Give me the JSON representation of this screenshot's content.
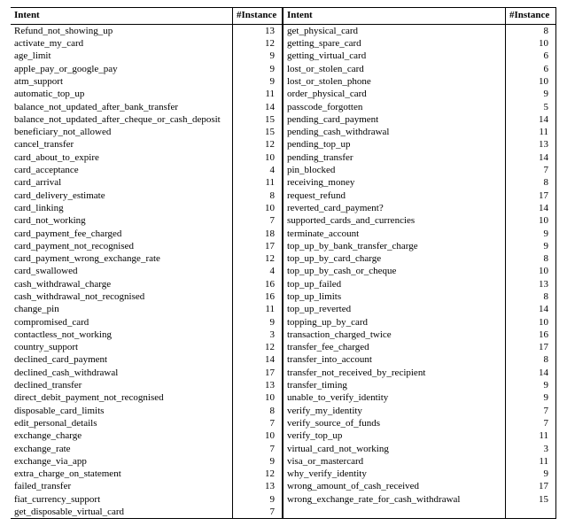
{
  "headers": {
    "intent": "Intent",
    "instance": "#Instance"
  },
  "left": [
    {
      "intent": "Refund_not_showing_up",
      "n": 13
    },
    {
      "intent": "activate_my_card",
      "n": 12
    },
    {
      "intent": "age_limit",
      "n": 9
    },
    {
      "intent": "apple_pay_or_google_pay",
      "n": 9
    },
    {
      "intent": "atm_support",
      "n": 9
    },
    {
      "intent": "automatic_top_up",
      "n": 11
    },
    {
      "intent": "balance_not_updated_after_bank_transfer",
      "n": 14
    },
    {
      "intent": "balance_not_updated_after_cheque_or_cash_deposit",
      "n": 15
    },
    {
      "intent": "beneficiary_not_allowed",
      "n": 15
    },
    {
      "intent": "cancel_transfer",
      "n": 12
    },
    {
      "intent": "card_about_to_expire",
      "n": 10
    },
    {
      "intent": "card_acceptance",
      "n": 4
    },
    {
      "intent": "card_arrival",
      "n": 11
    },
    {
      "intent": "card_delivery_estimate",
      "n": 8
    },
    {
      "intent": "card_linking",
      "n": 10
    },
    {
      "intent": "card_not_working",
      "n": 7
    },
    {
      "intent": "card_payment_fee_charged",
      "n": 18
    },
    {
      "intent": "card_payment_not_recognised",
      "n": 17
    },
    {
      "intent": "card_payment_wrong_exchange_rate",
      "n": 12
    },
    {
      "intent": "card_swallowed",
      "n": 4
    },
    {
      "intent": "cash_withdrawal_charge",
      "n": 16
    },
    {
      "intent": "cash_withdrawal_not_recognised",
      "n": 16
    },
    {
      "intent": "change_pin",
      "n": 11
    },
    {
      "intent": "compromised_card",
      "n": 9
    },
    {
      "intent": "contactless_not_working",
      "n": 3
    },
    {
      "intent": "country_support",
      "n": 12
    },
    {
      "intent": "declined_card_payment",
      "n": 14
    },
    {
      "intent": "declined_cash_withdrawal",
      "n": 17
    },
    {
      "intent": "declined_transfer",
      "n": 13
    },
    {
      "intent": "direct_debit_payment_not_recognised",
      "n": 10
    },
    {
      "intent": "disposable_card_limits",
      "n": 8
    },
    {
      "intent": "edit_personal_details",
      "n": 7
    },
    {
      "intent": "exchange_charge",
      "n": 10
    },
    {
      "intent": "exchange_rate",
      "n": 7
    },
    {
      "intent": "exchange_via_app",
      "n": 9
    },
    {
      "intent": "extra_charge_on_statement",
      "n": 12
    },
    {
      "intent": "failed_transfer",
      "n": 13
    },
    {
      "intent": "fiat_currency_support",
      "n": 9
    },
    {
      "intent": "get_disposable_virtual_card",
      "n": 7
    }
  ],
  "right": [
    {
      "intent": "get_physical_card",
      "n": 8
    },
    {
      "intent": "getting_spare_card",
      "n": 10
    },
    {
      "intent": "getting_virtual_card",
      "n": 6
    },
    {
      "intent": "lost_or_stolen_card",
      "n": 6
    },
    {
      "intent": "lost_or_stolen_phone",
      "n": 10
    },
    {
      "intent": "order_physical_card",
      "n": 9
    },
    {
      "intent": "passcode_forgotten",
      "n": 5
    },
    {
      "intent": "pending_card_payment",
      "n": 14
    },
    {
      "intent": "pending_cash_withdrawal",
      "n": 11
    },
    {
      "intent": "pending_top_up",
      "n": 13
    },
    {
      "intent": "pending_transfer",
      "n": 14
    },
    {
      "intent": "pin_blocked",
      "n": 7
    },
    {
      "intent": "receiving_money",
      "n": 8
    },
    {
      "intent": "request_refund",
      "n": 17
    },
    {
      "intent": "reverted_card_payment?",
      "n": 14
    },
    {
      "intent": "supported_cards_and_currencies",
      "n": 10
    },
    {
      "intent": "terminate_account",
      "n": 9
    },
    {
      "intent": "top_up_by_bank_transfer_charge",
      "n": 9
    },
    {
      "intent": "top_up_by_card_charge",
      "n": 8
    },
    {
      "intent": "top_up_by_cash_or_cheque",
      "n": 10
    },
    {
      "intent": "top_up_failed",
      "n": 13
    },
    {
      "intent": "top_up_limits",
      "n": 8
    },
    {
      "intent": "top_up_reverted",
      "n": 14
    },
    {
      "intent": "topping_up_by_card",
      "n": 10
    },
    {
      "intent": "transaction_charged_twice",
      "n": 16
    },
    {
      "intent": "transfer_fee_charged",
      "n": 17
    },
    {
      "intent": "transfer_into_account",
      "n": 8
    },
    {
      "intent": "transfer_not_received_by_recipient",
      "n": 14
    },
    {
      "intent": "transfer_timing",
      "n": 9
    },
    {
      "intent": "unable_to_verify_identity",
      "n": 9
    },
    {
      "intent": "verify_my_identity",
      "n": 7
    },
    {
      "intent": "verify_source_of_funds",
      "n": 7
    },
    {
      "intent": "verify_top_up",
      "n": 11
    },
    {
      "intent": "virtual_card_not_working",
      "n": 3
    },
    {
      "intent": "visa_or_mastercard",
      "n": 11
    },
    {
      "intent": "why_verify_identity",
      "n": 9
    },
    {
      "intent": "wrong_amount_of_cash_received",
      "n": 17
    },
    {
      "intent": "wrong_exchange_rate_for_cash_withdrawal",
      "n": 15
    },
    {
      "intent": "",
      "n": ""
    }
  ]
}
